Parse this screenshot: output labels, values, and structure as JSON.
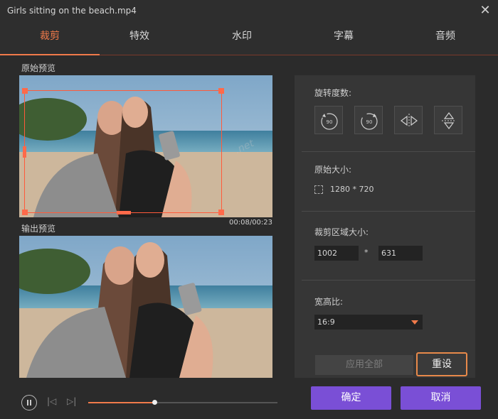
{
  "window": {
    "title": "Girls sitting on the beach.mp4",
    "close_glyph": "✕"
  },
  "tabs": [
    {
      "label": "裁剪",
      "active": true
    },
    {
      "label": "特效",
      "active": false
    },
    {
      "label": "水印",
      "active": false
    },
    {
      "label": "字幕",
      "active": false
    },
    {
      "label": "音频",
      "active": false
    }
  ],
  "preview": {
    "original_label": "原始预览",
    "output_label": "输出预览",
    "time": "00:08/00:23",
    "watermark": ".net"
  },
  "panel": {
    "rotate_label": "旋转度数:",
    "rotate_icons": [
      "rotate-left-90-icon",
      "rotate-right-90-icon",
      "flip-horizontal-icon",
      "flip-vertical-icon"
    ],
    "original_size_label": "原始大小:",
    "original_size_value": "1280 * 720",
    "crop_size_label": "裁剪区域大小:",
    "crop_width": "1002",
    "crop_sep": "*",
    "crop_height": "631",
    "ratio_label": "宽高比:",
    "ratio_value": "16:9"
  },
  "buttons": {
    "apply_all": "应用全部",
    "reset": "重设",
    "ok": "确定",
    "cancel": "取消"
  },
  "playback": {
    "progress_fraction": 0.35
  },
  "colors": {
    "accent": "#f07a4a",
    "primary_button": "#7a4fd6",
    "crop_box": "#ff5a3a"
  }
}
